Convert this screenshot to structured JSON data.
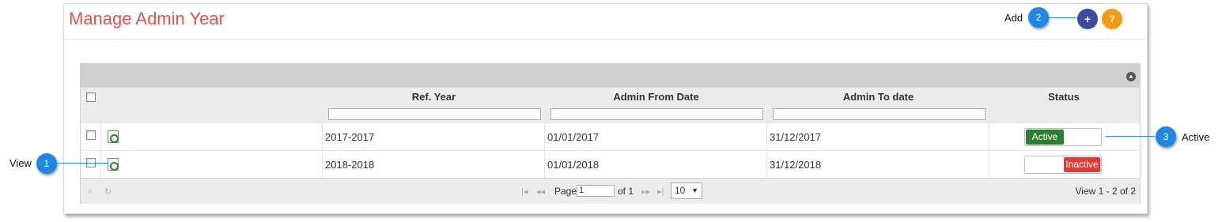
{
  "page": {
    "title": "Manage Admin Year"
  },
  "toolbar": {
    "add_symbol": "+",
    "help_symbol": "?"
  },
  "grid": {
    "columns": [
      "Ref. Year",
      "Admin From Date",
      "Admin To date",
      "Status"
    ],
    "rows": [
      {
        "ref_year": "2017-2017",
        "from_date": "01/01/2017",
        "to_date": "31/12/2017",
        "status": "Active"
      },
      {
        "ref_year": "2018-2018",
        "from_date": "01/01/2018",
        "to_date": "31/12/2018",
        "status": "Inactive"
      }
    ],
    "collapse_icon": "collapse-up-icon"
  },
  "pager": {
    "page_label": "Page",
    "page_value": "1",
    "of_label": "of 1",
    "page_size": "10",
    "view_count": "View 1 - 2 of 2",
    "icons": [
      "search-icon",
      "refresh-icon",
      "first-page-icon",
      "prev-page-icon",
      "next-page-icon",
      "last-page-icon"
    ]
  },
  "callouts": [
    {
      "number": "1",
      "label": "View"
    },
    {
      "number": "2",
      "label": "Add"
    },
    {
      "number": "3",
      "label": "Active"
    }
  ],
  "colors": {
    "title": "#e0534a",
    "add_button": "#3b4aa6",
    "help_button": "#f39a12",
    "active": "#2e7d32",
    "inactive": "#e53935",
    "callout": "#1e88e5"
  }
}
